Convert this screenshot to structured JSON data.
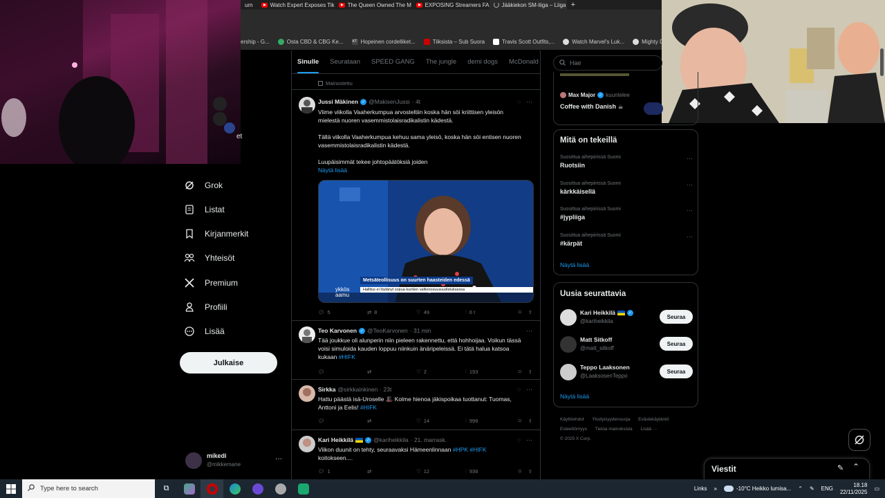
{
  "browser": {
    "tabs": [
      {
        "label": "Watch Expert Exposes Tik",
        "icon": "youtube-icon"
      },
      {
        "label": "The Queen Owned The M",
        "icon": "youtube-icon"
      },
      {
        "label": "EXPOSING Streamers FAK",
        "icon": "youtube-icon"
      },
      {
        "label": "Jääkiekon SM-liiga – Liiga",
        "icon": "loading-icon"
      }
    ],
    "partial_tab": "urn",
    "new_tab_symbol": "+",
    "bookmarks": [
      "ership - G...",
      "Osta CBD & CBG Ke...",
      "Hopeinen cordelliket...",
      "Tiiksista – Sub Suora",
      "Travis Scott Outfits,...",
      "Watch Marvel's Luk...",
      "Mighty Ducks: Ice..."
    ],
    "bookmark_badges": {
      "kt": "KT"
    }
  },
  "sidebar": {
    "partial_item": "et",
    "items": [
      {
        "label": "Grok",
        "icon": "grok-icon"
      },
      {
        "label": "Listat",
        "icon": "list-icon"
      },
      {
        "label": "Kirjanmerkit",
        "icon": "bookmark-icon"
      },
      {
        "label": "Yhteisöt",
        "icon": "communities-icon"
      },
      {
        "label": "Premium",
        "icon": "x-logo-icon"
      },
      {
        "label": "Profiili",
        "icon": "profile-icon"
      },
      {
        "label": "Lisää",
        "icon": "more-circle-icon"
      }
    ],
    "post_button": "Julkaise",
    "account": {
      "name": "mikedi",
      "handle": "@mikkemane",
      "more": "···"
    }
  },
  "feed": {
    "tabs": [
      "Sinulle",
      "Seurataan",
      "SPEED GANG",
      "The jungle",
      "demi dogs",
      "McDonald"
    ],
    "promoted_label": "Mainostettu",
    "tweets": [
      {
        "name": "Jussi Mäkinen",
        "handle": "@MakisenJussi",
        "time": "· 4t",
        "text1": "Viime viikolla Vaaherkumpua arvosteltiin koska hän söi kriittisen yleisön mielestä nuoren vasemmistolaisradikalistin kädestä.",
        "text2": "Tällä viikolla Vaaherkumpua kehuu sama yleisö, koska hän söi entisen nuoren vasemmistolaisradikalistin kädestä.",
        "text3": "Luupäisimmät tekee johtopäätöksiä joiden",
        "show_more": "Näytä lisää",
        "media_caption": "Metsäteollisuus on suurten haasteiden edessä",
        "media_ticker": "Hallitus ei löytänyt sopua kuntien valtionosuusuudistuksessa",
        "media_logo": "ykkös aamu",
        "replies": "5",
        "reposts": "8",
        "likes": "49",
        "views": "6 t"
      },
      {
        "name": "Teo Karvonen",
        "handle": "@TeoKarvonen",
        "time": "· 31 min",
        "text": "Tää joukkue oli alunperin niin pieleen rakennettu, että hohhoijaa. Voikun tässä voisi simuloida kauden loppuu niinkuin änäripeleissä. Ei tätä halua katsoa kukaan",
        "hashtag": "#HIFK",
        "replies": "",
        "reposts": "",
        "likes": "2",
        "views": "193"
      },
      {
        "name": "Sirkka",
        "handle": "@sirkkainkinen",
        "time": "· 23t",
        "text": "Hattu päästä isä-Uroselle 🎩 Kolme hienoa jäkispoikaa tuottanut: Tuomas, Anttoni ja Eelis!",
        "hashtag": "#HIFK",
        "replies": "",
        "reposts": "",
        "likes": "14",
        "views": "998"
      },
      {
        "name": "Kari Heikkilä",
        "handle": "@kariheikkila",
        "time": "· 21. marrask.",
        "text": "Viikon duunit on tehty, seuraavaksi Hämeenlinnaan",
        "hashtag": "#HPK #HIFK",
        "text_end": "koitokseen....",
        "replies": "1",
        "reposts": "",
        "likes": "12",
        "views": "936"
      }
    ]
  },
  "right": {
    "search_placeholder": "Hae",
    "live": {
      "host": "Max Major",
      "status": "kuuntelee",
      "title": "Coffee with Danish ☕"
    },
    "trends_title": "Mitä on tekeillä",
    "trends": [
      {
        "context": "Suosittua aihepiirissä Suomi",
        "name": "Ruotsiin"
      },
      {
        "context": "Suosittua aihepiirissä Suomi",
        "name": "kärkkäisellä"
      },
      {
        "context": "Suosittua aihepiirissä Suomi",
        "name": "#jypliiga"
      },
      {
        "context": "Suosittua aihepiirissä Suomi",
        "name": "#kärpät"
      }
    ],
    "show_more": "Näytä lisää",
    "follow_title": "Uusia seurattavia",
    "follow": [
      {
        "name": "Kari Heikkilä",
        "handle": "@kariheikkila",
        "button": "Seuraa"
      },
      {
        "name": "Matt Sitkoff",
        "handle": "@matt_sitkoff",
        "button": "Seuraa"
      },
      {
        "name": "Teppo Laaksonen",
        "handle": "@LaaksosenTeppo",
        "button": "Seuraa"
      }
    ],
    "footer": [
      "Käyttöehdot",
      "Yksityisyydensuoja",
      "Evästekäytäntö",
      "Esteettömyys",
      "Tietoa mainoksista",
      "Lisää ···",
      "© 2025 X Corp."
    ]
  },
  "messages": {
    "title": "Viestit"
  },
  "taskbar": {
    "search_placeholder": "Type here to search",
    "links": "Links",
    "weather": "-10°C  Heikko lumisa...",
    "lang": "ENG",
    "time": "18.18",
    "date": "22/11/2025"
  },
  "colors": {
    "accent": "#1d9bf0",
    "bg": "#000000",
    "border": "#2f3336",
    "muted": "#71767b"
  }
}
